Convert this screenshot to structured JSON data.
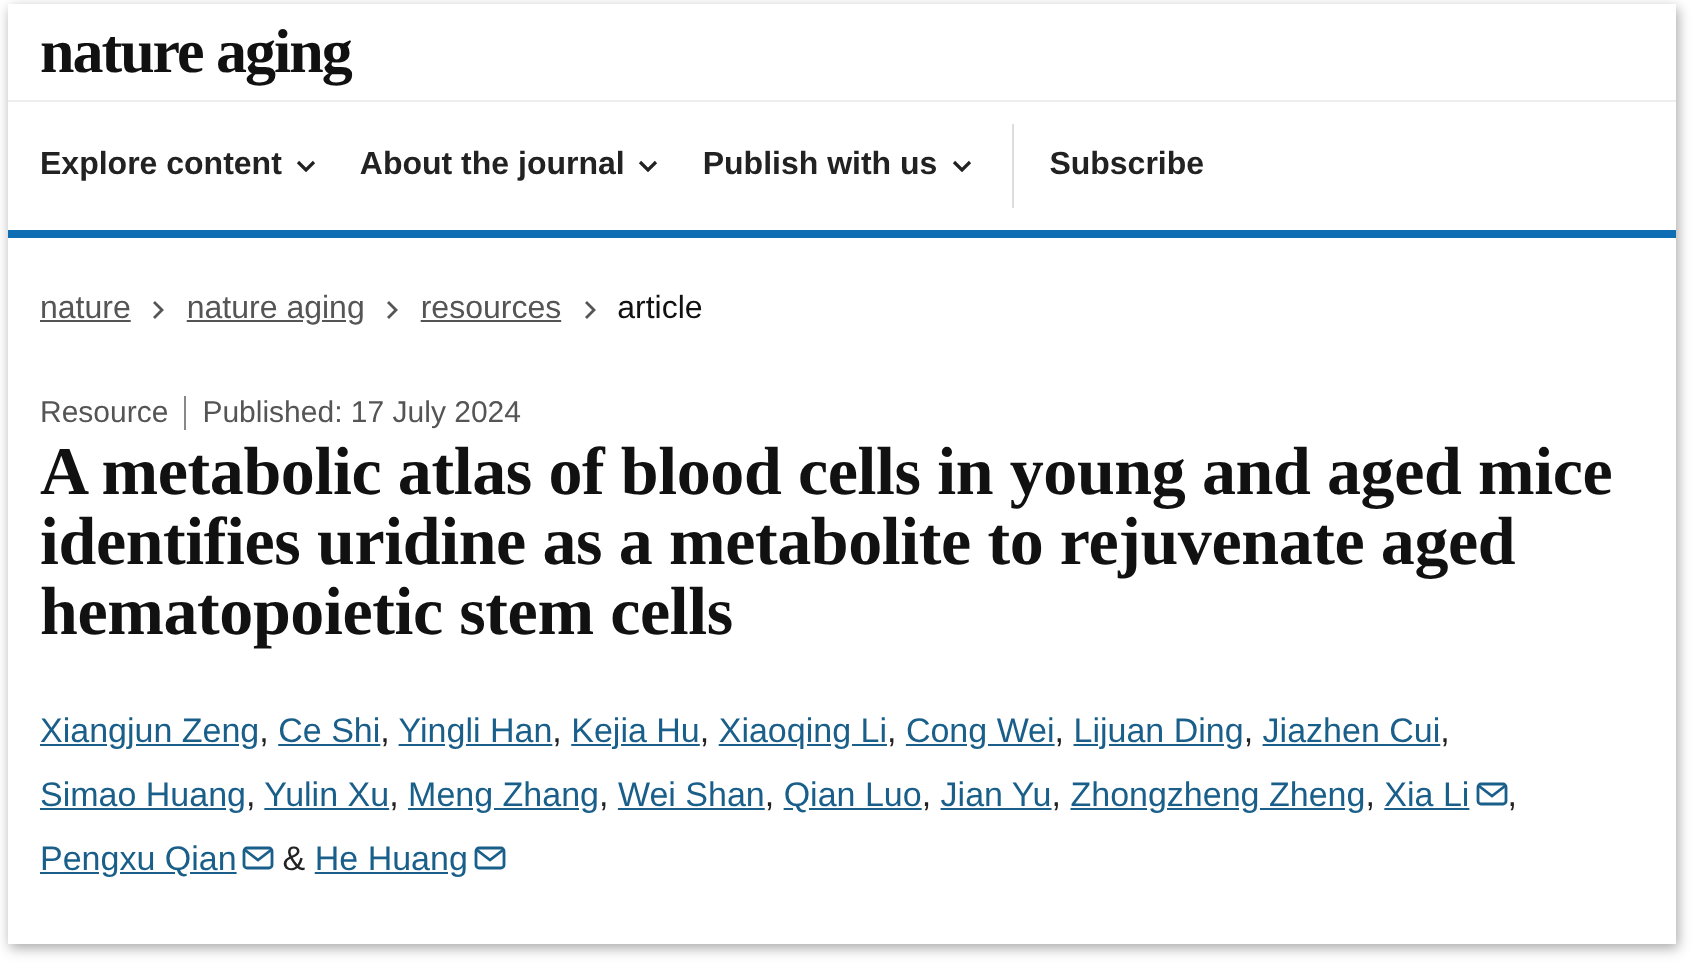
{
  "logo": "nature aging",
  "nav": [
    {
      "label": "Explore content",
      "dropdown": true
    },
    {
      "label": "About the journal",
      "dropdown": true
    },
    {
      "label": "Publish with us",
      "dropdown": true
    },
    {
      "label": "Subscribe",
      "dropdown": false
    }
  ],
  "breadcrumb": [
    {
      "label": "nature",
      "link": true
    },
    {
      "label": "nature aging",
      "link": true
    },
    {
      "label": "resources",
      "link": true
    },
    {
      "label": "article",
      "link": false
    }
  ],
  "article_type": "Resource",
  "published": "Published: 17 July 2024",
  "title": "A metabolic atlas of blood cells in young and aged mice identifies uridine as a metabolite to rejuvenate aged hematopoietic stem cells",
  "authors": [
    {
      "name": "Xiangjun Zeng",
      "email": false,
      "after": ","
    },
    {
      "name": "Ce Shi",
      "email": false,
      "after": ","
    },
    {
      "name": "Yingli Han",
      "email": false,
      "after": ","
    },
    {
      "name": "Kejia Hu",
      "email": false,
      "after": ","
    },
    {
      "name": "Xiaoqing Li",
      "email": false,
      "after": ","
    },
    {
      "name": "Cong Wei",
      "email": false,
      "after": ","
    },
    {
      "name": "Lijuan Ding",
      "email": false,
      "after": ","
    },
    {
      "name": "Jiazhen Cui",
      "email": false,
      "after": ","
    },
    {
      "name": "Simao Huang",
      "email": false,
      "after": ","
    },
    {
      "name": "Yulin Xu",
      "email": false,
      "after": ","
    },
    {
      "name": "Meng Zhang",
      "email": false,
      "after": ","
    },
    {
      "name": "Wei Shan",
      "email": false,
      "after": ","
    },
    {
      "name": "Qian Luo",
      "email": false,
      "after": ","
    },
    {
      "name": "Jian Yu",
      "email": false,
      "after": ","
    },
    {
      "name": "Zhongzheng Zheng",
      "email": false,
      "after": ","
    },
    {
      "name": "Xia Li",
      "email": true,
      "after": ","
    },
    {
      "name": "Pengxu Qian",
      "email": true,
      "after": "&"
    },
    {
      "name": "He Huang",
      "email": true
    }
  ]
}
